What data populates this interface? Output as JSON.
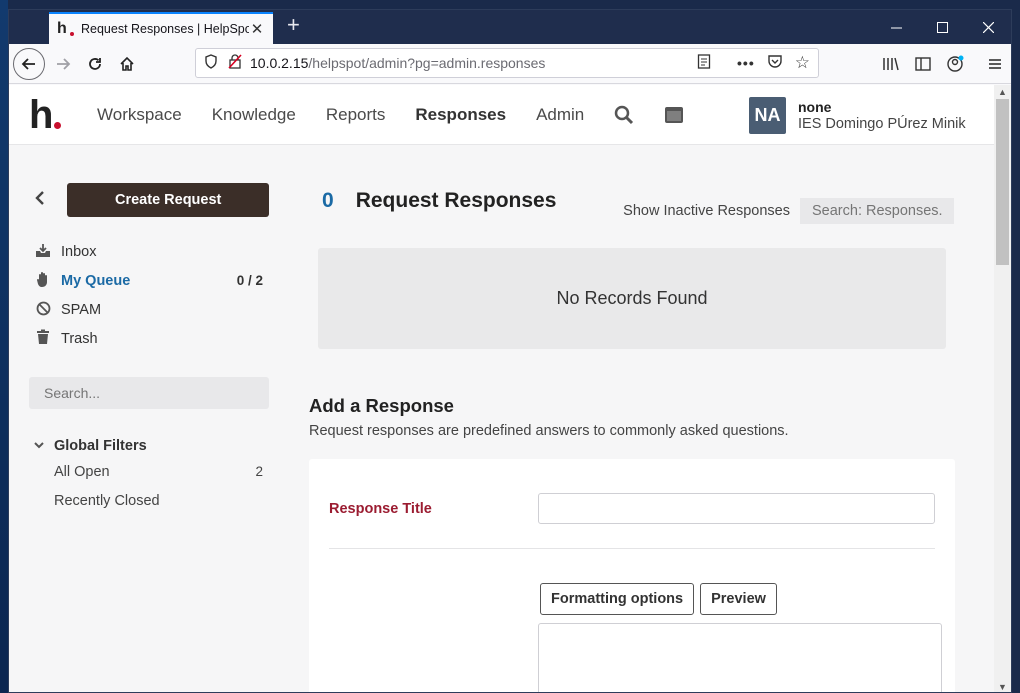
{
  "browser": {
    "tab_title": "Request Responses | HelpSpot",
    "tab_favicon": "h",
    "url_host": "10.0.2.15",
    "url_path": "/helpspot/admin?pg=admin.responses"
  },
  "app": {
    "logo": "h",
    "nav": {
      "workspace": "Workspace",
      "knowledge": "Knowledge",
      "reports": "Reports",
      "responses": "Responses",
      "admin": "Admin"
    },
    "user": {
      "initials": "NA",
      "name": "none",
      "org": "IES Domingo PÚrez Minik"
    }
  },
  "sidebar": {
    "create_button": "Create Request",
    "items": [
      {
        "label": "Inbox",
        "icon": "inbox-icon",
        "count": ""
      },
      {
        "label": "My Queue",
        "icon": "hand-icon",
        "count": "0 / 2"
      },
      {
        "label": "SPAM",
        "icon": "ban-icon",
        "count": ""
      },
      {
        "label": "Trash",
        "icon": "trash-icon",
        "count": ""
      }
    ],
    "search_placeholder": "Search...",
    "filters": {
      "title": "Global Filters",
      "items": [
        {
          "label": "All Open",
          "count": "2"
        },
        {
          "label": "Recently Closed",
          "count": ""
        }
      ]
    }
  },
  "main": {
    "count": "0",
    "title": "Request Responses",
    "show_inactive": "Show Inactive Responses",
    "search_placeholder": "Search: Responses.",
    "empty_message": "No Records Found",
    "add_title": "Add a Response",
    "add_description": "Request responses are predefined answers to commonly asked questions.",
    "field_title_label": "Response Title",
    "formatting_button": "Formatting options",
    "preview_button": "Preview"
  },
  "colors": {
    "accent_blue": "#1b6aa5",
    "required_label": "#9b1c31",
    "create_button_bg": "#3b2e28",
    "logo_dot": "#c8102e"
  }
}
